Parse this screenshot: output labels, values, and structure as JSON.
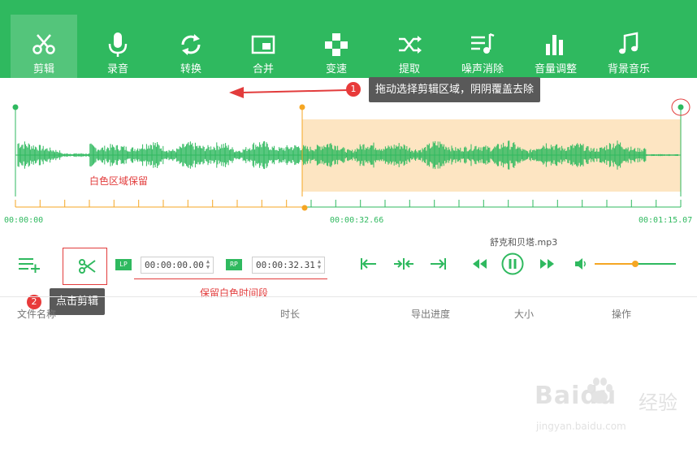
{
  "toolbar": {
    "items": [
      {
        "label": "剪辑",
        "icon": "scissors-icon",
        "active": true
      },
      {
        "label": "录音",
        "icon": "microphone-icon"
      },
      {
        "label": "转换",
        "icon": "sync-icon"
      },
      {
        "label": "合并",
        "icon": "merge-icon"
      },
      {
        "label": "变速",
        "icon": "speed-icon"
      },
      {
        "label": "提取",
        "icon": "shuffle-icon"
      },
      {
        "label": "噪声消除",
        "icon": "denoise-icon"
      },
      {
        "label": "音量调整",
        "icon": "volume-bars-icon"
      },
      {
        "label": "背景音乐",
        "icon": "music-note-icon"
      }
    ]
  },
  "waveform": {
    "time_start": "00:00:00",
    "time_mid": "00:00:32.66",
    "time_end": "00:01:15.07",
    "keep_label": "白色区域保留",
    "selection_start_fraction": 0.43
  },
  "annotations": {
    "tip1_number": "1",
    "tip1_text": "拖动选择剪辑区域，阴阴覆盖去除",
    "tip2_number": "2",
    "tip2_text": "点击剪辑",
    "keep_time_label": "保留白色时间段"
  },
  "controls": {
    "filename": "舒克和贝塔.mp3",
    "lp_tag": "LP",
    "rp_tag": "RP",
    "lp_time": "00:00:00.00",
    "rp_time": "00:00:32.31",
    "volume_fraction": 0.5
  },
  "table": {
    "headers": [
      "文件名称",
      "时长",
      "导出进度",
      "大小",
      "操作"
    ]
  },
  "watermark": {
    "brand": "Baidu",
    "cn": "经验",
    "url": "jingyan.baidu.com"
  },
  "colors": {
    "accent": "#2fb95f",
    "selection": "#fde5c2",
    "marker": "#f5a623",
    "annotation_red": "#e23c3c"
  }
}
